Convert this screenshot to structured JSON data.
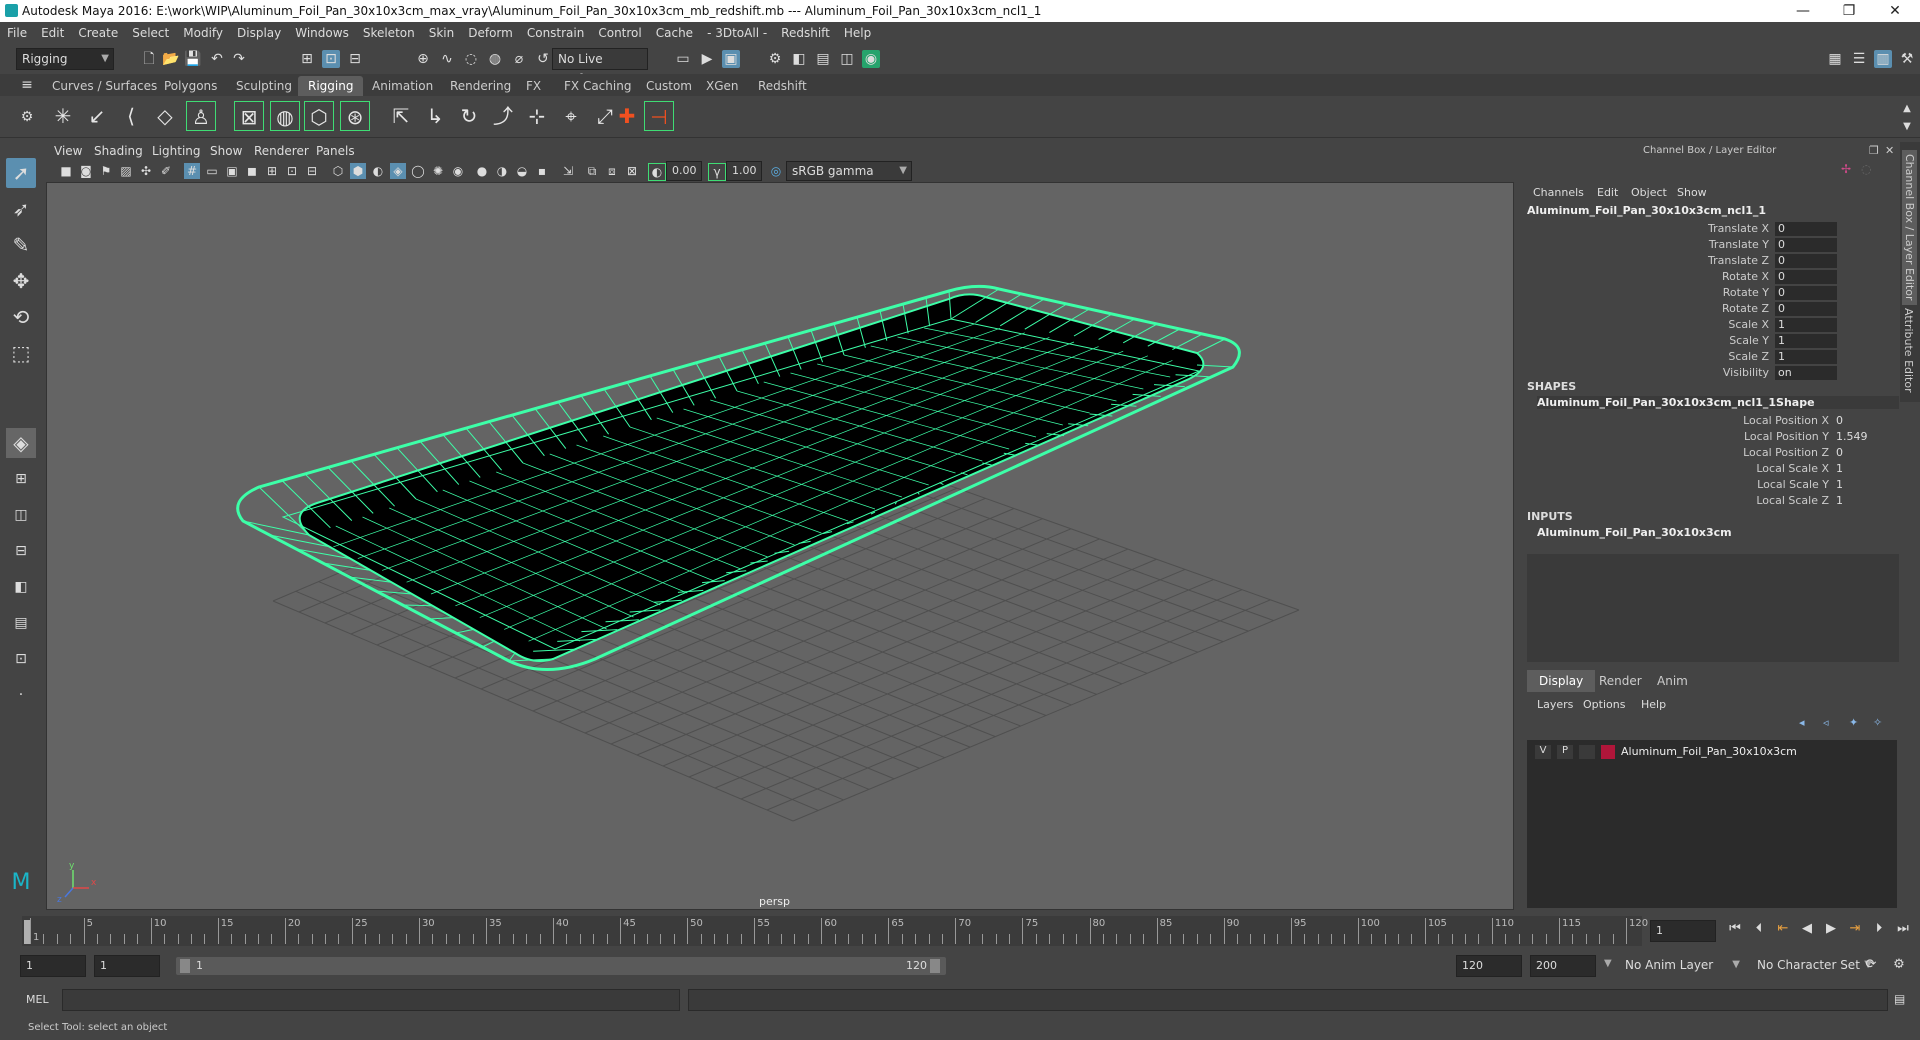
{
  "window": {
    "title": "Autodesk Maya 2016: E:\\work\\WIP\\Aluminum_Foil_Pan_30x10x3cm_max_vray\\Aluminum_Foil_Pan_30x10x3cm_mb_redshift.mb  ---   Aluminum_Foil_Pan_30x10x3cm_ncl1_1",
    "minimize": "—",
    "maximize": "❐",
    "close": "✕"
  },
  "menubar": [
    "File",
    "Edit",
    "Create",
    "Select",
    "Modify",
    "Display",
    "Windows",
    "Skeleton",
    "Skin",
    "Deform",
    "Constrain",
    "Control",
    "Cache",
    "- 3DtoAll -",
    "Redshift",
    "Help"
  ],
  "status_line": {
    "menuset": "Rigging",
    "live_surface": "No Live Surface"
  },
  "shelf": {
    "tabs": [
      "Curves / Surfaces",
      "Polygons",
      "Sculpting",
      "Rigging",
      "Animation",
      "Rendering",
      "FX",
      "FX Caching",
      "Custom",
      "XGen",
      "Redshift"
    ],
    "active_tab": "Rigging"
  },
  "viewport": {
    "menu": [
      "View",
      "Shading",
      "Lighting",
      "Show",
      "Renderer",
      "Panels"
    ],
    "exposure": "0.00",
    "gamma": "1.00",
    "color_space": "sRGB gamma",
    "camera_label": "persp",
    "axis_x": "x",
    "axis_y": "y",
    "axis_z": "z",
    "wire_color": "#3dffa8",
    "bg_color": "#646464"
  },
  "channel_box": {
    "header": "Channel Box / Layer Editor",
    "menu": [
      "Channels",
      "Edit",
      "Object",
      "Show"
    ],
    "object_name": "Aluminum_Foil_Pan_30x10x3cm_ncl1_1",
    "channels": [
      {
        "label": "Translate X",
        "value": "0"
      },
      {
        "label": "Translate Y",
        "value": "0"
      },
      {
        "label": "Translate Z",
        "value": "0"
      },
      {
        "label": "Rotate X",
        "value": "0"
      },
      {
        "label": "Rotate Y",
        "value": "0"
      },
      {
        "label": "Rotate Z",
        "value": "0"
      },
      {
        "label": "Scale X",
        "value": "1"
      },
      {
        "label": "Scale Y",
        "value": "1"
      },
      {
        "label": "Scale Z",
        "value": "1"
      },
      {
        "label": "Visibility",
        "value": "on"
      }
    ],
    "shapes_heading": "SHAPES",
    "shape_name": "Aluminum_Foil_Pan_30x10x3cm_ncl1_1Shape",
    "shape_channels": [
      {
        "label": "Local Position X",
        "value": "0"
      },
      {
        "label": "Local Position Y",
        "value": "1.549"
      },
      {
        "label": "Local Position Z",
        "value": "0"
      },
      {
        "label": "Local Scale X",
        "value": "1"
      },
      {
        "label": "Local Scale Y",
        "value": "1"
      },
      {
        "label": "Local Scale Z",
        "value": "1"
      }
    ],
    "inputs_heading": "INPUTS",
    "input_name": "Aluminum_Foil_Pan_30x10x3cm"
  },
  "layer_editor": {
    "tabs": [
      "Display",
      "Render",
      "Anim"
    ],
    "active_tab": "Display",
    "menu": [
      "Layers",
      "Options",
      "Help"
    ],
    "layer": {
      "v": "V",
      "p": "P",
      "name": "Aluminum_Foil_Pan_30x10x3cm",
      "color": "#b0163a"
    }
  },
  "side_tabs": [
    "Channel Box / Layer Editor",
    "Attribute Editor"
  ],
  "timeline": {
    "ticks": [
      "1",
      "5",
      "10",
      "15",
      "20",
      "25",
      "30",
      "35",
      "40",
      "45",
      "50",
      "55",
      "60",
      "65",
      "70",
      "75",
      "80",
      "85",
      "90",
      "95",
      "100",
      "105",
      "110",
      "115",
      "120"
    ],
    "current_frame": "1"
  },
  "range": {
    "start": "1",
    "playback_start": "1",
    "range_start_label": "1",
    "range_end_label": "120",
    "playback_end": "120",
    "end": "200",
    "anim_layer": "No Anim Layer",
    "character_set": "No Character Set"
  },
  "command_line": {
    "label": "MEL"
  },
  "help_line": "Select Tool: select an object"
}
